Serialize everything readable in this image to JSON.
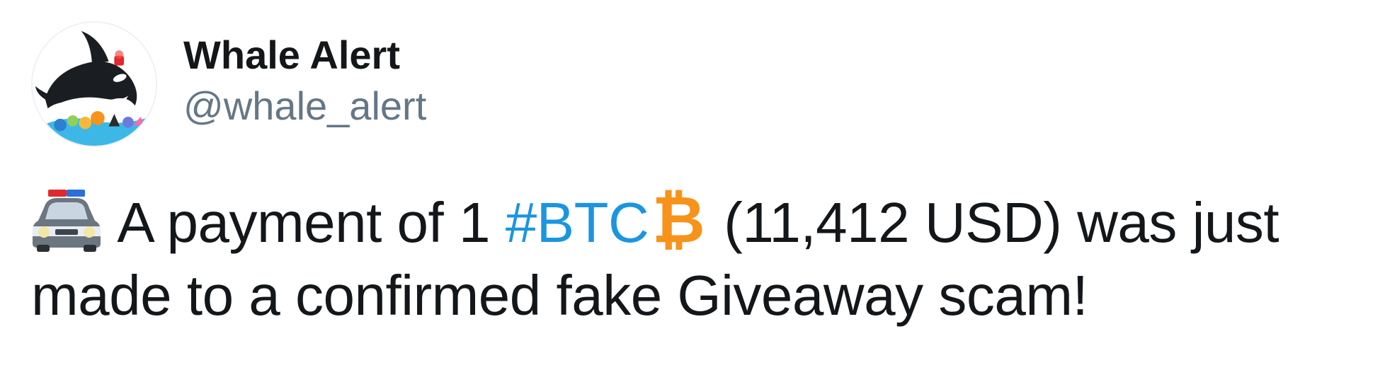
{
  "author": {
    "display_name": "Whale Alert",
    "handle": "@whale_alert",
    "avatar_icon": "orca-whale-logo-icon"
  },
  "tweet": {
    "lead_emoji": "police-car-icon",
    "text_before_hashtag": "A payment of 1",
    "hashtag": "#BTC",
    "hashtag_emoji": "bitcoin-icon",
    "text_after_hashtag": "(11,412 USD) was just",
    "text_line2": "made to a confirmed fake Giveaway scam!"
  },
  "colors": {
    "text": "#14171a",
    "handle": "#657786",
    "hashtag": "#1b95e0",
    "bitcoin": "#f7931a"
  }
}
